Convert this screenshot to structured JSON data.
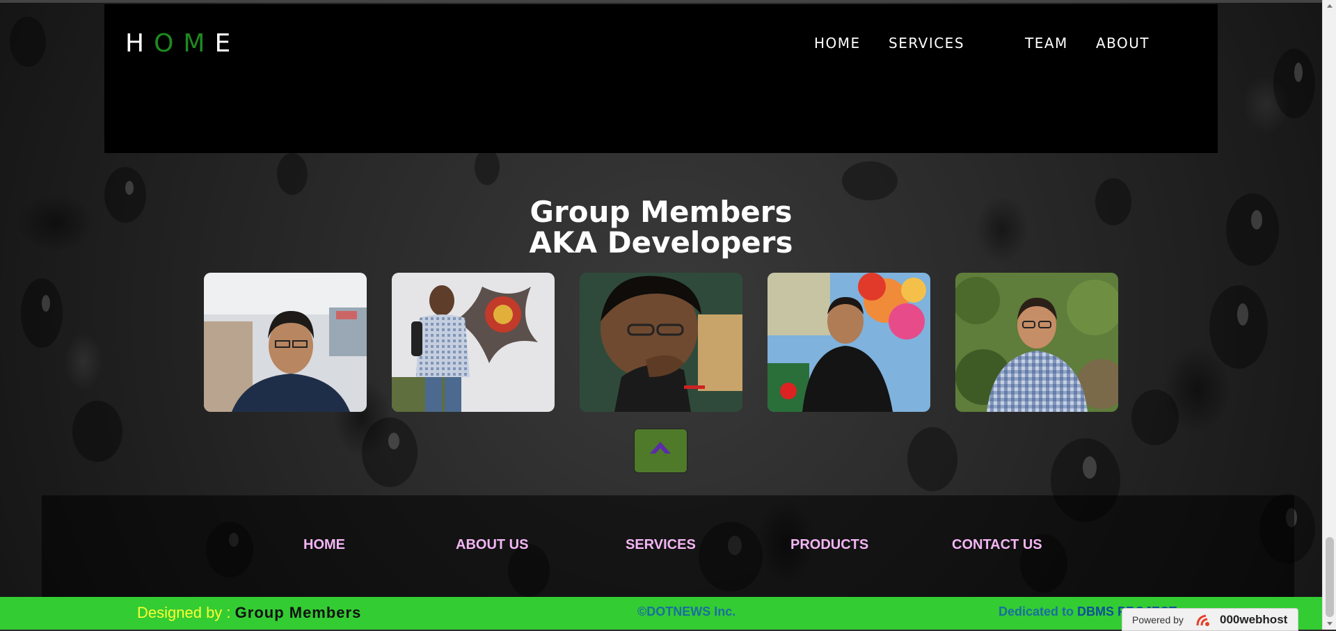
{
  "navbar": {
    "logo_letters": [
      "H",
      "O",
      "M",
      "E"
    ],
    "links": [
      "HOME",
      "SERVICES",
      "TEAM",
      "ABOUT"
    ]
  },
  "section": {
    "title_line1": "Group Members",
    "title_line2": "AKA Developers"
  },
  "members": [
    {
      "id": "member-1"
    },
    {
      "id": "member-2"
    },
    {
      "id": "member-3"
    },
    {
      "id": "member-4"
    },
    {
      "id": "member-5"
    }
  ],
  "footer_nav": [
    "HOME",
    "ABOUT US",
    "SERVICES",
    "PRODUCTS",
    "CONTACT US"
  ],
  "bottom_bar": {
    "designed_label": "Designed by : ",
    "designed_by": "Group Members",
    "copyright": "©DOTNEWS Inc.",
    "dedicated_label": "Dedicated to ",
    "dedicated_project": "DBMS PROJECT"
  },
  "badge": {
    "powered_by": "Powered by",
    "brand": "000webhost"
  },
  "colors": {
    "accent_green": "#1f8a1f",
    "bottom_bar": "#33cc33",
    "footer_links": "#f4b6f4",
    "scroll_button": "#4e7a2a"
  },
  "icons": {
    "scroll_top": "chevron-up-icon",
    "badge_logo": "000webhost-logo-icon"
  }
}
